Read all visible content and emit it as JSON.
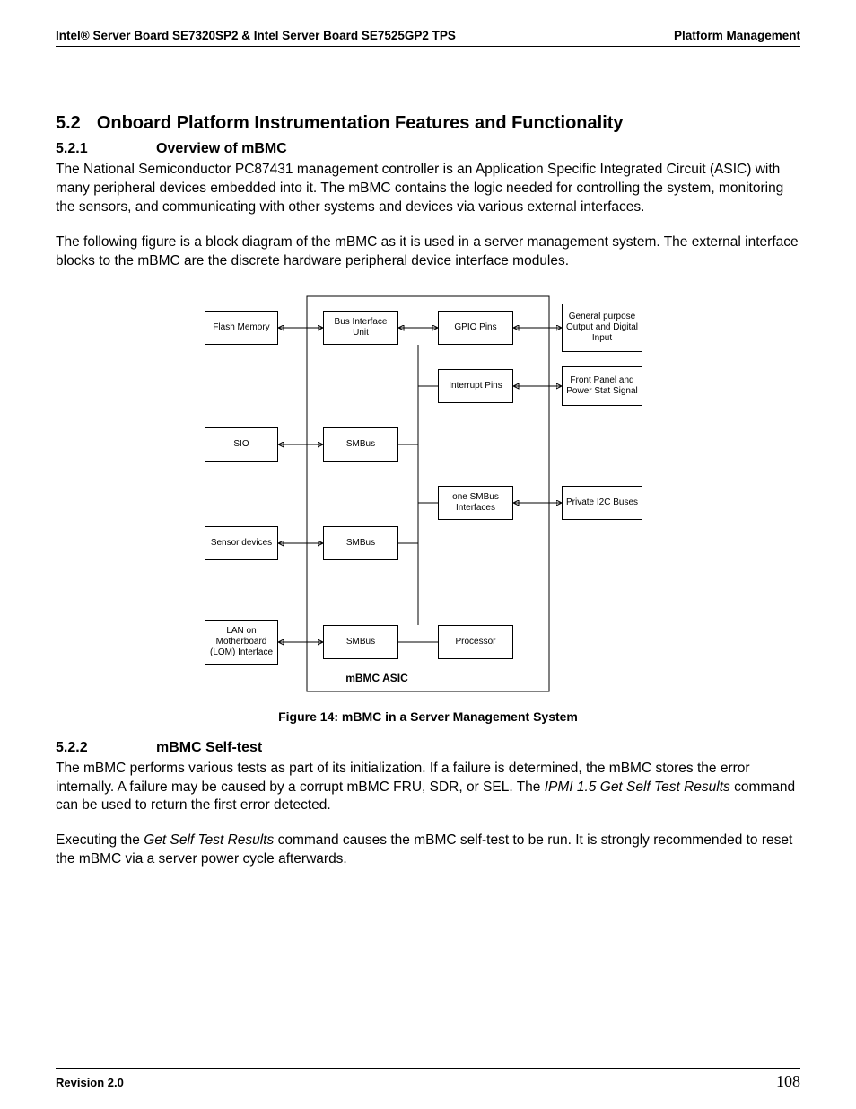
{
  "header": {
    "left": "Intel® Server Board SE7320SP2 & Intel Server Board SE7525GP2 TPS",
    "right": "Platform Management"
  },
  "s52": {
    "num": "5.2",
    "title": "Onboard Platform Instrumentation Features and Functionality"
  },
  "s521": {
    "num": "5.2.1",
    "title": "Overview of mBMC",
    "p1": "The National Semiconductor PC87431 management controller is an Application Specific Integrated Circuit (ASIC) with many peripheral devices embedded into it. The mBMC contains the logic needed for controlling the system, monitoring the sensors, and communicating with other systems and devices via various external interfaces.",
    "p2": "The following figure is a block diagram of the mBMC as it is used in a server management system. The external interface blocks to the mBMC are the discrete hardware peripheral device interface modules."
  },
  "diagram": {
    "flash": "Flash Memory",
    "biu": "Bus Interface Unit",
    "gpio": "GPIO Pins",
    "gpo": "General purpose Output and Digital Input",
    "intr": "Interrupt Pins",
    "fp": "Front Panel and Power Stat Signal",
    "sio": "SIO",
    "smbus1": "SMBus",
    "onesmbus": "one SMBus Interfaces",
    "pi2c": "Private I2C Buses",
    "sensor": "Sensor devices",
    "smbus2": "SMBus",
    "lom": "LAN on Motherboard (LOM) Interface",
    "smbus3": "SMBus",
    "proc": "Processor",
    "asic": "mBMC ASIC"
  },
  "caption": "Figure 14: mBMC in a Server Management System",
  "s522": {
    "num": "5.2.2",
    "title": "mBMC Self-test",
    "p1a": "The mBMC performs various tests as part of its initialization. If a failure is determined, the mBMC stores the error internally. A failure may be caused by a corrupt mBMC FRU, SDR, or SEL.  The ",
    "p1b": "IPMI 1.5 Get Self Test Results",
    "p1c": " command can be used to return the first error detected.",
    "p2a": "Executing the ",
    "p2b": "Get Self Test Results",
    "p2c": " command causes the mBMC self-test to be run. It is strongly recommended to reset the mBMC via a server power cycle afterwards."
  },
  "footer": {
    "rev": "Revision 2.0",
    "page": "108"
  }
}
